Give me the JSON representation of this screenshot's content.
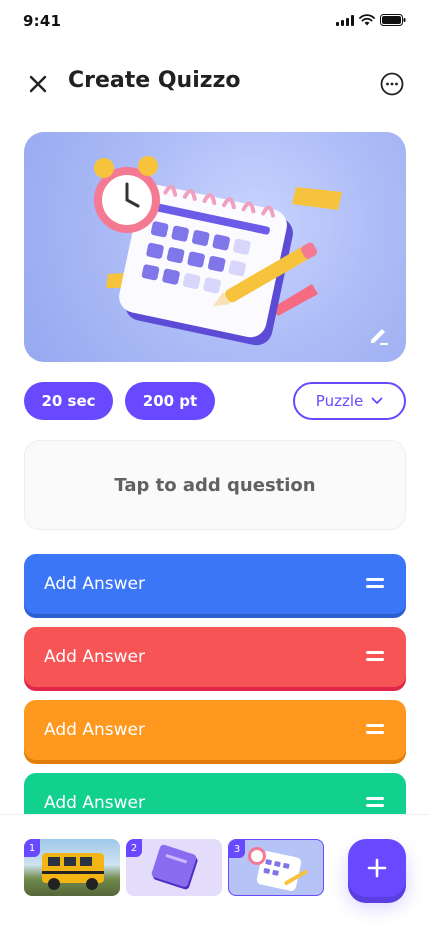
{
  "status": {
    "time": "9:41"
  },
  "header": {
    "title": "Create Quizzo",
    "close_icon": "close-icon",
    "more_icon": "more-icon"
  },
  "cover": {
    "illustration": "calendar-clock-pencil",
    "edit_icon": "edit-icon"
  },
  "chips": {
    "time_label": "20 sec",
    "points_label": "200 pt",
    "type_label": "Puzzle"
  },
  "question": {
    "placeholder": "Tap to add question"
  },
  "answers": [
    {
      "label": "Add Answer",
      "color": "#3b76f6"
    },
    {
      "label": "Add Answer",
      "color": "#f75555"
    },
    {
      "label": "Add Answer",
      "color": "#ff981f"
    },
    {
      "label": "Add Answer",
      "color": "#12d18e"
    }
  ],
  "slides": [
    {
      "number": "1",
      "thumbnail": "school-bus"
    },
    {
      "number": "2",
      "thumbnail": "purple-book"
    },
    {
      "number": "3",
      "thumbnail": "calendar-clock",
      "selected": true
    }
  ],
  "colors": {
    "primary": "#6949ff"
  }
}
